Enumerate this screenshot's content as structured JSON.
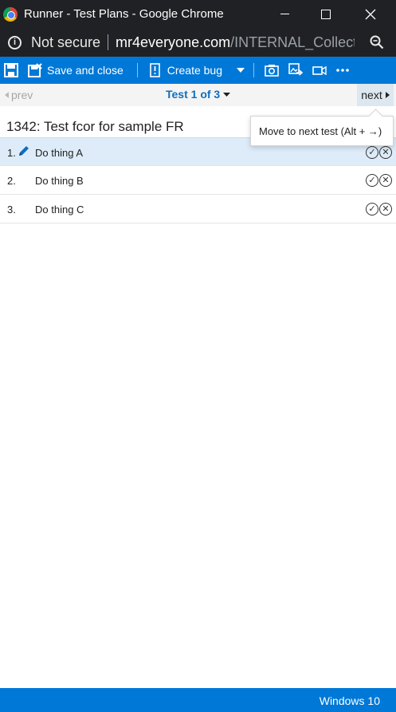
{
  "window": {
    "title": "Runner - Test Plans - Google Chrome"
  },
  "address_bar": {
    "security_label": "Not secure",
    "url_host": "mr4everyone.com",
    "url_path": "/INTERNAL_Collect..."
  },
  "toolbar": {
    "save_label": "Save and close",
    "create_bug_label": "Create bug"
  },
  "navigation": {
    "prev_label": "prev",
    "position_label": "Test 1 of 3",
    "next_label": "next"
  },
  "tooltip": {
    "text": "Move to next test (Alt + →)"
  },
  "test": {
    "title": "1342: Test fcor for sample FR",
    "steps": [
      {
        "number": "1.",
        "text": "Do thing A"
      },
      {
        "number": "2.",
        "text": "Do thing B"
      },
      {
        "number": "3.",
        "text": "Do thing C"
      }
    ]
  },
  "status_bar": {
    "text": "Windows 10"
  },
  "icons": {
    "app": "chrome-logo-icon",
    "security": "info-icon",
    "zoom": "zoom-icon",
    "save": "save-icon",
    "create_bug": "bug-icon",
    "screenshot": "camera-icon",
    "image_action": "image-action-icon",
    "record": "video-icon",
    "more": "more-icon"
  },
  "colors": {
    "accent": "#0078d7",
    "active_row": "#deecf9",
    "chrome_dark": "#202124",
    "nav_blue": "#106ebe"
  }
}
